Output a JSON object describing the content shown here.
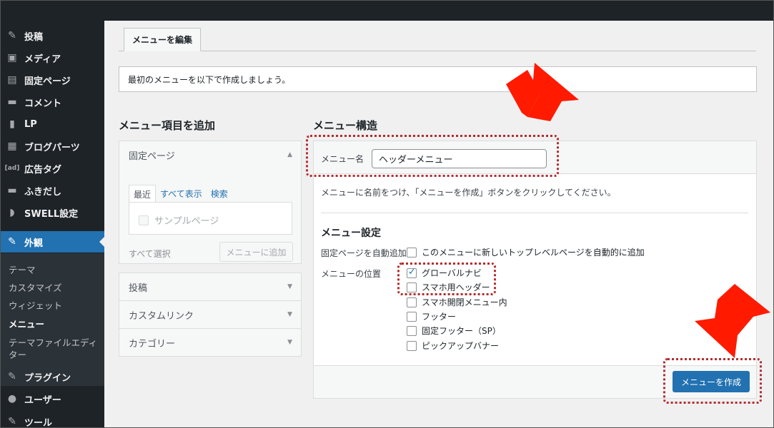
{
  "sidebar": {
    "items": [
      {
        "icon": "pin-icon",
        "glyph": "✎",
        "label": "投稿"
      },
      {
        "icon": "media-icon",
        "glyph": "▣",
        "label": "メディア"
      },
      {
        "icon": "page-icon",
        "glyph": "▤",
        "label": "固定ページ"
      },
      {
        "icon": "comment-icon",
        "glyph": "▬",
        "label": "コメント"
      },
      {
        "icon": "document-icon",
        "glyph": "▮",
        "label": "LP"
      },
      {
        "icon": "grid-icon",
        "glyph": "▦",
        "label": "ブログパーツ"
      },
      {
        "icon": "ad-icon",
        "glyph": "[ad]",
        "label": "広告タグ"
      },
      {
        "icon": "balloon-icon",
        "glyph": "▬",
        "label": "ふきだし"
      },
      {
        "icon": "swell-icon",
        "glyph": "◗",
        "label": "SWELL設定"
      },
      {
        "icon": "brush-icon",
        "glyph": "✎",
        "label": "外観"
      },
      {
        "icon": "plugin-icon",
        "glyph": "✎",
        "label": "プラグイン"
      },
      {
        "icon": "user-icon",
        "glyph": "●",
        "label": "ユーザー"
      },
      {
        "icon": "tools-icon",
        "glyph": "✎",
        "label": "ツール"
      }
    ],
    "submenu": [
      "テーマ",
      "カスタマイズ",
      "ウィジェット",
      "メニュー",
      "テーマファイルエディ",
      "ター"
    ]
  },
  "tab": {
    "label": "メニューを編集"
  },
  "notice": "最初のメニューを以下で作成しましょう。",
  "add_items": {
    "heading": "メニュー項目を追加",
    "sections": [
      {
        "label": "固定ページ",
        "expanded": true
      },
      {
        "label": "投稿"
      },
      {
        "label": "カスタムリンク"
      },
      {
        "label": "カテゴリー"
      }
    ],
    "tabs": [
      "最近",
      "すべて表示",
      "検索"
    ],
    "sample_page": "サンプルページ",
    "select_all": "すべて選択",
    "add_button": "メニューに追加"
  },
  "structure": {
    "heading": "メニュー構造",
    "name_label": "メニュー名",
    "name_value": "ヘッダーメニュー",
    "hint": "メニューに名前をつけ、「メニューを作成」ボタンをクリックしてください。",
    "settings_heading": "メニュー設定",
    "auto_add_label": "固定ページを自動追加",
    "auto_add_text": "このメニューに新しいトップレベルページを自動的に追加",
    "location_label": "メニューの位置",
    "locations": [
      {
        "label": "グローバルナビ",
        "checked": true
      },
      {
        "label": "スマホ用ヘッダー",
        "checked": false
      },
      {
        "label": "スマホ開閉メニュー内",
        "checked": false
      },
      {
        "label": "フッター",
        "checked": false
      },
      {
        "label": "固定フッター（SP）",
        "checked": false
      },
      {
        "label": "ピックアップバナー",
        "checked": false
      }
    ],
    "create_button": "メニューを作成"
  },
  "colors": {
    "accent": "#2271b1",
    "sidebar": "#1d2327",
    "annotation": "#ff1a00",
    "dotted_box": "#b32d2e"
  }
}
